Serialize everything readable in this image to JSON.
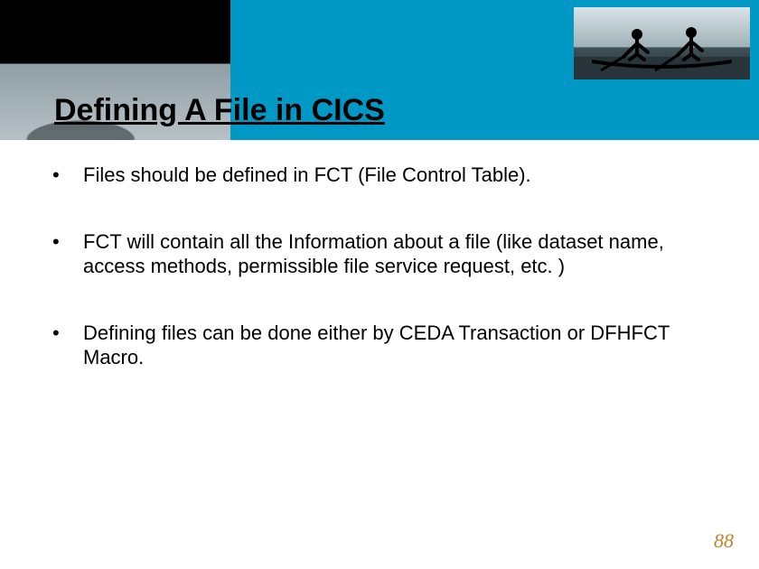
{
  "title": "Defining A File in CICS",
  "bullets": [
    "Files should be defined in FCT (File Control Table).",
    "FCT will contain all the Information about a file (like dataset name, access methods, permissible file service request, etc. )",
    "Defining files can be done either by CEDA Transaction or DFHFCT Macro."
  ],
  "page_number": "88"
}
